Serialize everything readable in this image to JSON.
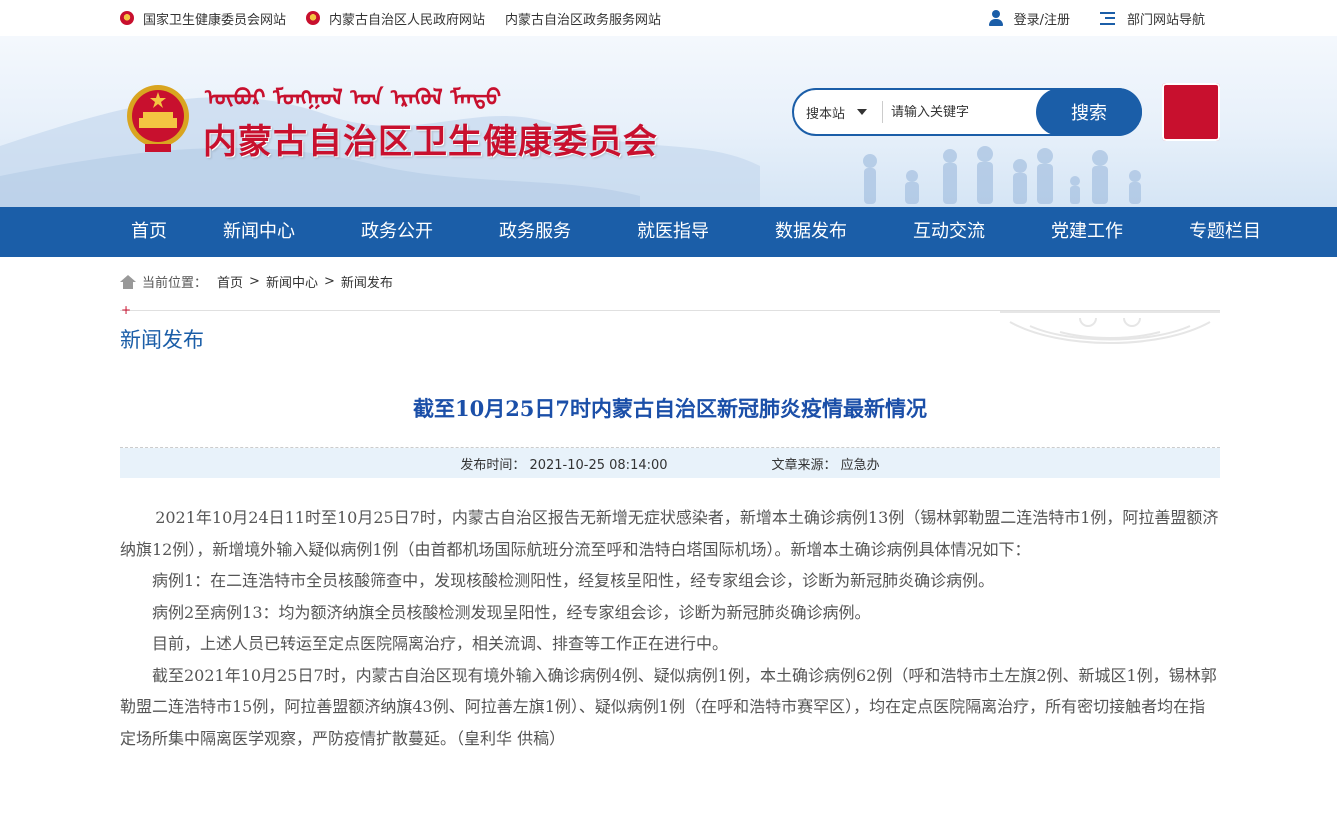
{
  "top_links": [
    "国家卫生健康委员会网站",
    "内蒙古自治区人民政府网站",
    "内蒙古自治区政务服务网站"
  ],
  "top_right": {
    "login": "登录/注册",
    "dept_nav": "部门网站导航"
  },
  "header": {
    "mongolian_script": "ᠥᠪᠥᠷ ᠮᠣᠩᠭᠣᠯ ᠤᠨ ᠡᠷᠡᠭᠦᠯ ᠮᠡᠨᠳᠦ",
    "site_title": "内蒙古自治区卫生健康委员会",
    "seal_text": "内蒙古"
  },
  "search": {
    "scope": "搜本站",
    "placeholder": "请输入关键字",
    "button": "搜索"
  },
  "nav": [
    "首页",
    "新闻中心",
    "政务公开",
    "政务服务",
    "就医指导",
    "数据发布",
    "互动交流",
    "党建工作",
    "专题栏目"
  ],
  "breadcrumb": {
    "label": "当前位置：",
    "items": [
      "首页",
      "新闻中心",
      "新闻发布"
    ],
    "sep": ">"
  },
  "section": {
    "plus": "+",
    "title": "新闻发布"
  },
  "article": {
    "title": "截至10月25日7时内蒙古自治区新冠肺炎疫情最新情况",
    "publish_time": "发布时间：  2021-10-25 08:14:00",
    "source": "文章来源：  应急办",
    "paragraphs": [
      "2021年10月24日11时至10月25日7时，内蒙古自治区报告无新增无症状感染者，新增本土确诊病例13例（锡林郭勒盟二连浩特市1例，阿拉善盟额济纳旗12例），新增境外输入疑似病例1例（由首都机场国际航班分流至呼和浩特白塔国际机场）。新增本土确诊病例具体情况如下：",
      "病例1：在二连浩特市全员核酸筛查中，发现核酸检测阳性，经复核呈阳性，经专家组会诊，诊断为新冠肺炎确诊病例。",
      "病例2至病例13：均为额济纳旗全员核酸检测发现呈阳性，经专家组会诊，诊断为新冠肺炎确诊病例。",
      "目前，上述人员已转运至定点医院隔离治疗，相关流调、排查等工作正在进行中。",
      "截至2021年10月25日7时，内蒙古自治区现有境外输入确诊病例4例、疑似病例1例，本土确诊病例62例（呼和浩特市土左旗2例、新城区1例，锡林郭勒盟二连浩特市15例，阿拉善盟额济纳旗43例、阿拉善左旗1例）、疑似病例1例（在呼和浩特市赛罕区），均在定点医院隔离治疗，所有密切接触者均在指定场所集中隔离医学观察，严防疫情扩散蔓延。（皇利华 供稿）"
    ]
  },
  "colors": {
    "brand_blue": "#1b5ea8",
    "title_red": "#c8102e",
    "meta_bg": "#e8f2fa"
  }
}
